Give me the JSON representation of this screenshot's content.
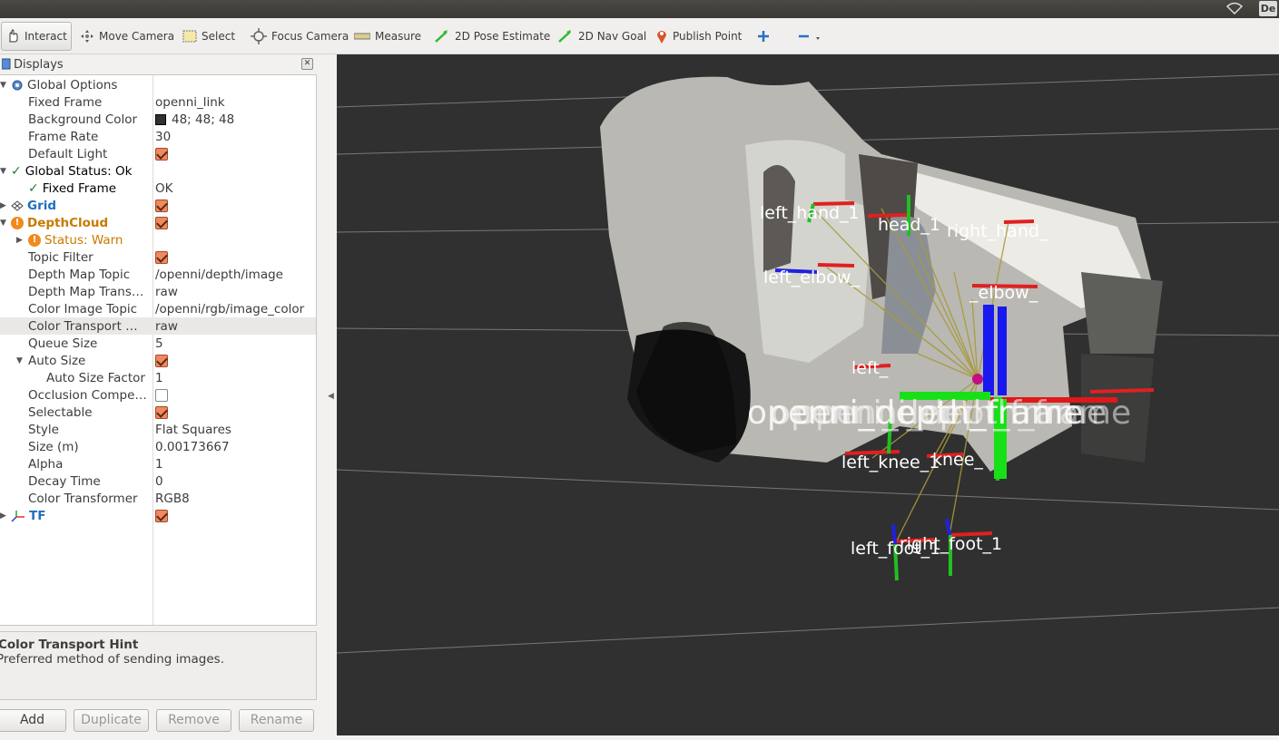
{
  "toolbar": {
    "tools": [
      {
        "label": "Interact",
        "icon": "hand-icon"
      },
      {
        "label": "Move Camera",
        "icon": "move-camera-icon"
      },
      {
        "label": "Select",
        "icon": "select-icon"
      },
      {
        "label": "Focus Camera",
        "icon": "focus-camera-icon"
      },
      {
        "label": "Measure",
        "icon": "ruler-icon"
      },
      {
        "label": "2D Pose Estimate",
        "icon": "pose-arrow-icon"
      },
      {
        "label": "2D Nav Goal",
        "icon": "nav-arrow-icon"
      },
      {
        "label": "Publish Point",
        "icon": "map-pin-icon"
      }
    ],
    "tray": {
      "keyboard": "De"
    }
  },
  "displays": {
    "title": "Displays",
    "rows": [
      {
        "name": "Global Options",
        "value": ""
      },
      {
        "name": "Fixed Frame",
        "value": "openni_link"
      },
      {
        "name": "Background Color",
        "value": "48; 48; 48"
      },
      {
        "name": "Frame Rate",
        "value": "30"
      },
      {
        "name": "Default Light",
        "value": ""
      },
      {
        "name": "Global Status: Ok",
        "value": ""
      },
      {
        "name": "Fixed Frame",
        "value": "OK"
      },
      {
        "name": "Grid",
        "value": ""
      },
      {
        "name": "DepthCloud",
        "value": ""
      },
      {
        "name": "Status: Warn",
        "value": ""
      },
      {
        "name": "Topic Filter",
        "value": ""
      },
      {
        "name": "Depth Map Topic",
        "value": "/openni/depth/image"
      },
      {
        "name": "Depth Map Trans…",
        "value": "raw"
      },
      {
        "name": "Color Image Topic",
        "value": "/openni/rgb/image_color"
      },
      {
        "name": "Color Transport …",
        "value": "raw"
      },
      {
        "name": "Queue Size",
        "value": "5"
      },
      {
        "name": "Auto Size",
        "value": ""
      },
      {
        "name": "Auto Size Factor",
        "value": "1"
      },
      {
        "name": "Occlusion Compe…",
        "value": ""
      },
      {
        "name": "Selectable",
        "value": ""
      },
      {
        "name": "Style",
        "value": "Flat Squares"
      },
      {
        "name": "Size (m)",
        "value": "0.00173667"
      },
      {
        "name": "Alpha",
        "value": "1"
      },
      {
        "name": "Decay Time",
        "value": "0"
      },
      {
        "name": "Color Transformer",
        "value": "RGB8"
      },
      {
        "name": "TF",
        "value": ""
      }
    ]
  },
  "hint": {
    "title": "Color Transport Hint",
    "description": "Preferred method of sending images."
  },
  "buttons": {
    "add": "Add",
    "duplicate": "Duplicate",
    "remove": "Remove",
    "rename": "Rename"
  },
  "viewport": {
    "frame_labels": [
      "left_hand_1",
      "head_1",
      "right_hand_",
      "left_elbow_",
      "_elbow_",
      "left_",
      "left_knee_1",
      "knee_",
      "left_foot_1",
      "right_foot_1",
      "openni_depth_frame"
    ]
  }
}
